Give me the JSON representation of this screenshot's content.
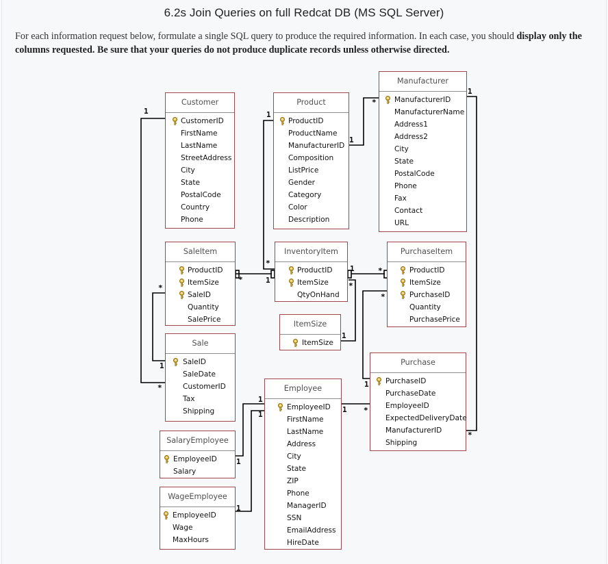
{
  "title": "6.2s Join Queries on full Redcat DB (MS SQL Server)",
  "intro": {
    "text": "For each information request below, formulate a single SQL query to produce the required information.  In each case, you should ",
    "bold1": "display only the columns requested.  Be sure that your queries do not produce duplicate records unless otherwise directed."
  },
  "diagram": {
    "tables": {
      "customer": {
        "name": "Customer",
        "fields": [
          {
            "name": "CustomerID",
            "pk": true
          },
          {
            "name": "FirstName"
          },
          {
            "name": "LastName"
          },
          {
            "name": "StreetAddress"
          },
          {
            "name": "City"
          },
          {
            "name": "State"
          },
          {
            "name": "PostalCode"
          },
          {
            "name": "Country"
          },
          {
            "name": "Phone"
          }
        ]
      },
      "product": {
        "name": "Product",
        "fields": [
          {
            "name": "ProductID",
            "pk": true
          },
          {
            "name": "ProductName"
          },
          {
            "name": "ManufacturerID"
          },
          {
            "name": "Composition"
          },
          {
            "name": "ListPrice"
          },
          {
            "name": "Gender"
          },
          {
            "name": "Category"
          },
          {
            "name": "Color"
          },
          {
            "name": "Description"
          }
        ]
      },
      "manufacturer": {
        "name": "Manufacturer",
        "fields": [
          {
            "name": "ManufacturerID",
            "pk": true
          },
          {
            "name": "ManufacturerName"
          },
          {
            "name": "Address1"
          },
          {
            "name": "Address2"
          },
          {
            "name": "City"
          },
          {
            "name": "State"
          },
          {
            "name": "PostalCode"
          },
          {
            "name": "Phone"
          },
          {
            "name": "Fax"
          },
          {
            "name": "Contact"
          },
          {
            "name": "URL"
          }
        ]
      },
      "saleitem": {
        "name": "SaleItem",
        "fields": [
          {
            "name": "ProductID",
            "pk": true
          },
          {
            "name": "ItemSize",
            "pk": true
          },
          {
            "name": "SaleID",
            "pk": true
          },
          {
            "name": "Quantity"
          },
          {
            "name": "SalePrice"
          }
        ]
      },
      "inventoryitem": {
        "name": "InventoryItem",
        "fields": [
          {
            "name": "ProductID",
            "pk": true
          },
          {
            "name": "ItemSize",
            "pk": true
          },
          {
            "name": "QtyOnHand"
          }
        ]
      },
      "purchaseitem": {
        "name": "PurchaseItem",
        "fields": [
          {
            "name": "ProductID",
            "pk": true
          },
          {
            "name": "ItemSize",
            "pk": true
          },
          {
            "name": "PurchaseID",
            "pk": true
          },
          {
            "name": "Quantity"
          },
          {
            "name": "PurchasePrice"
          }
        ]
      },
      "itemsize": {
        "name": "ItemSize",
        "fields": [
          {
            "name": "ItemSize",
            "pk": true
          }
        ]
      },
      "sale": {
        "name": "Sale",
        "fields": [
          {
            "name": "SaleID",
            "pk": true
          },
          {
            "name": "SaleDate"
          },
          {
            "name": "CustomerID"
          },
          {
            "name": "Tax"
          },
          {
            "name": "Shipping"
          }
        ]
      },
      "purchase": {
        "name": "Purchase",
        "fields": [
          {
            "name": "PurchaseID",
            "pk": true
          },
          {
            "name": "PurchaseDate"
          },
          {
            "name": "EmployeeID"
          },
          {
            "name": "ExpectedDeliveryDate"
          },
          {
            "name": "ManufacturerID"
          },
          {
            "name": "Shipping"
          }
        ]
      },
      "employee": {
        "name": "Employee",
        "fields": [
          {
            "name": "EmployeeID",
            "pk": true
          },
          {
            "name": "FirstName"
          },
          {
            "name": "LastName"
          },
          {
            "name": "Address"
          },
          {
            "name": "City"
          },
          {
            "name": "State"
          },
          {
            "name": "ZIP"
          },
          {
            "name": "Phone"
          },
          {
            "name": "ManagerID"
          },
          {
            "name": "SSN"
          },
          {
            "name": "EmailAddress"
          },
          {
            "name": "HireDate"
          }
        ]
      },
      "salaryemployee": {
        "name": "SalaryEmployee",
        "fields": [
          {
            "name": "EmployeeID",
            "pk": true
          },
          {
            "name": "Salary"
          }
        ]
      },
      "wageemployee": {
        "name": "WageEmployee",
        "fields": [
          {
            "name": "EmployeeID",
            "pk": true
          },
          {
            "name": "Wage"
          },
          {
            "name": "MaxHours"
          }
        ]
      }
    },
    "relationships": [
      {
        "from": "Customer.CustomerID",
        "to": "Sale.CustomerID",
        "one": "1",
        "many": "*"
      },
      {
        "from": "Product.ProductID",
        "to": "InventoryItem.ProductID",
        "one": "1",
        "many": "*"
      },
      {
        "from": "Manufacturer.ManufacturerID",
        "to": "Product.ManufacturerID",
        "one": "1",
        "many": "*"
      },
      {
        "from": "Manufacturer.ManufacturerID",
        "to": "Purchase.ManufacturerID",
        "one": "1",
        "many": "*"
      },
      {
        "from": "InventoryItem",
        "to": "SaleItem",
        "one": "1",
        "many": "*"
      },
      {
        "from": "InventoryItem",
        "to": "PurchaseItem",
        "one": "1",
        "many": "*"
      },
      {
        "from": "ItemSize.ItemSize",
        "to": "InventoryItem.ItemSize",
        "one": "1",
        "many": "*"
      },
      {
        "from": "Sale.SaleID",
        "to": "SaleItem.SaleID",
        "one": "1",
        "many": "*"
      },
      {
        "from": "Purchase.PurchaseID",
        "to": "PurchaseItem.PurchaseID",
        "one": "1",
        "many": "*"
      },
      {
        "from": "Employee.EmployeeID",
        "to": "Purchase.EmployeeID",
        "one": "1",
        "many": "*"
      },
      {
        "from": "Employee.EmployeeID",
        "to": "SalaryEmployee.EmployeeID",
        "one": "1",
        "many": "1"
      },
      {
        "from": "Employee.EmployeeID",
        "to": "WageEmployee.EmployeeID",
        "one": "1",
        "many": "1"
      }
    ],
    "labels": {
      "one": "1",
      "many": "*"
    }
  }
}
